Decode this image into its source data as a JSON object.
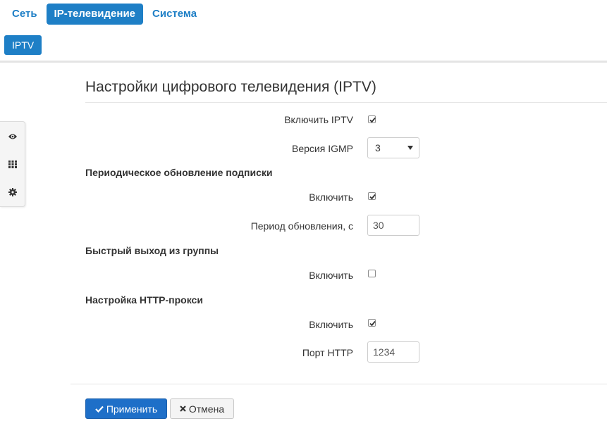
{
  "nav": {
    "tabs": [
      {
        "label": "Сеть",
        "active": false
      },
      {
        "label": "IP-телевидение",
        "active": true
      },
      {
        "label": "Система",
        "active": false
      }
    ],
    "subtabs": [
      {
        "label": "IPTV",
        "active": true
      }
    ]
  },
  "sidebar": {
    "icons": [
      "eye-icon",
      "grid-icon",
      "gear-icon"
    ]
  },
  "page": {
    "title": "Настройки цифрового телевидения (IPTV)"
  },
  "form": {
    "enable_iptv": {
      "label": "Включить IPTV",
      "checked": true
    },
    "igmp_version": {
      "label": "Версия IGMP",
      "value": "3"
    },
    "periodic_update": {
      "heading": "Периодическое обновление подписки",
      "enable": {
        "label": "Включить",
        "checked": true
      },
      "period": {
        "label": "Период обновления, с",
        "value": "30"
      }
    },
    "fast_leave": {
      "heading": "Быстрый выход из группы",
      "enable": {
        "label": "Включить",
        "checked": false
      }
    },
    "http_proxy": {
      "heading": "Настройка HTTP-прокси",
      "enable": {
        "label": "Включить",
        "checked": true
      },
      "port": {
        "label": "Порт HTTP",
        "value": "1234"
      }
    }
  },
  "buttons": {
    "apply": "Применить",
    "cancel": "Отмена"
  },
  "colors": {
    "accent": "#1e7fc6",
    "primary_button": "#1e6fc8"
  }
}
